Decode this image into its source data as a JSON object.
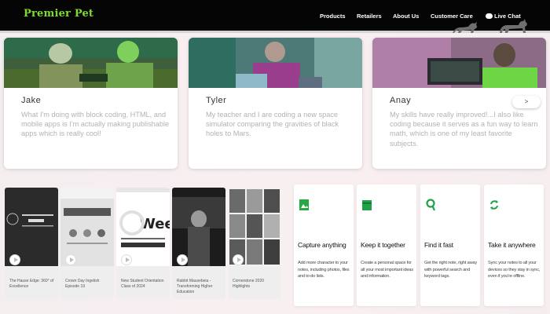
{
  "header": {
    "logo": "Premier Pet",
    "nav": [
      "Products",
      "Retailers",
      "About Us",
      "Customer Care",
      "Live Chat"
    ],
    "brand_color": "#7fdc2c"
  },
  "testimonials": [
    {
      "name": "Jake",
      "quote": "What I'm doing with block coding, HTML, and mobile apps is I'm actually making publishable apps which is really cool!"
    },
    {
      "name": "Tyler",
      "quote": "My teacher and I are coding a new space simulator comparing the gravities of black holes to Mars."
    },
    {
      "name": "Anay",
      "quote": "My skills have really improved!...I also like coding because it serves as a fun way to learn math, which is one of my least favorite subjects."
    }
  ],
  "carousel_next": ">",
  "videos": [
    {
      "title": "The Hause Edge: 360° of Excellence"
    },
    {
      "title": "Crown Day Ingelish Episode 19"
    },
    {
      "title": "New Student Orientation Class of 2024"
    },
    {
      "title": "Rabbit Mausebeia - Transforming Higher Education"
    },
    {
      "title": "Cornerstone 2020 Highlights"
    }
  ],
  "features": [
    {
      "title": "Capture anything",
      "desc": "Add more character to your notes, including photos, files and to-do lists.",
      "icon": "image-icon"
    },
    {
      "title": "Keep it together",
      "desc": "Create a personal space for all your most important ideas and information.",
      "icon": "folder-icon"
    },
    {
      "title": "Find it fast",
      "desc": "Get the right note, right away with powerful search and keyword tags.",
      "icon": "search-icon"
    },
    {
      "title": "Take it anywhere",
      "desc": "Sync your notes to all your devices so they stay in sync, even if you're offline.",
      "icon": "sync-icon"
    }
  ]
}
